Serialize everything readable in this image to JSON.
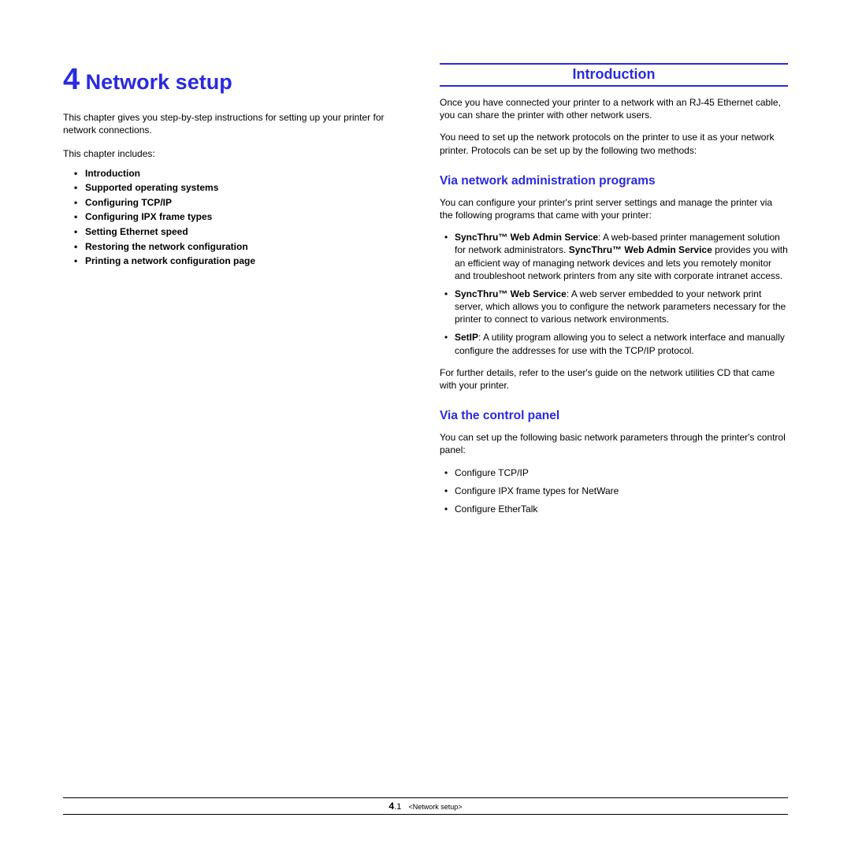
{
  "left": {
    "chapter_number": "4",
    "chapter_title": "Network setup",
    "intro": "This chapter gives you step-by-step instructions for setting up your printer for network connections.",
    "includes_line": "This chapter includes:",
    "toc": [
      "Introduction",
      "Supported operating systems",
      "Configuring TCP/IP",
      "Configuring IPX frame types",
      "Setting Ethernet speed",
      "Restoring the network configuration",
      "Printing a network configuration page"
    ]
  },
  "right": {
    "section_title": "Introduction",
    "para1": "Once you have connected your printer to a network with an RJ-45 Ethernet cable, you can share the printer with other network users.",
    "para2": "You need to set up the network protocols on the printer to use it as your network printer. Protocols can be set up by the following two methods:",
    "sub1_title": "Via network administration programs",
    "sub1_intro": "You can configure your printer's print server settings and manage the printer via the following programs that came with your printer:",
    "programs": [
      {
        "bold1": "SyncThru™ Web Admin Service",
        "plain1": ": A web-based printer management solution for network administrators. ",
        "bold2": "SyncThru™ Web Admin Service",
        "plain2": " provides you with an efficient way of managing network devices and lets you remotely monitor and troubleshoot network printers from any site with corporate intranet access."
      },
      {
        "bold1": "SyncThru™ Web Service",
        "plain1": ": A web server embedded to your network print server, which allows you to configure the network parameters necessary for the printer to connect to various network environments.",
        "bold2": "",
        "plain2": ""
      },
      {
        "bold1": "SetIP",
        "plain1": ": A utility program allowing you to select a network interface and manually configure the addresses for use with the TCP/IP protocol.",
        "bold2": "",
        "plain2": ""
      }
    ],
    "sub1_outro": "For further details, refer to the user's guide on the network utilities CD that came with your printer.",
    "sub2_title": "Via the control panel",
    "sub2_intro": "You can set up the following basic network parameters through the printer's control panel:",
    "panel_items": [
      "Configure TCP/IP",
      "Configure IPX frame types for NetWare",
      "Configure EtherTalk"
    ]
  },
  "footer": {
    "page_major": "4",
    "page_minor": ".1",
    "crumb": "<Network setup>"
  }
}
